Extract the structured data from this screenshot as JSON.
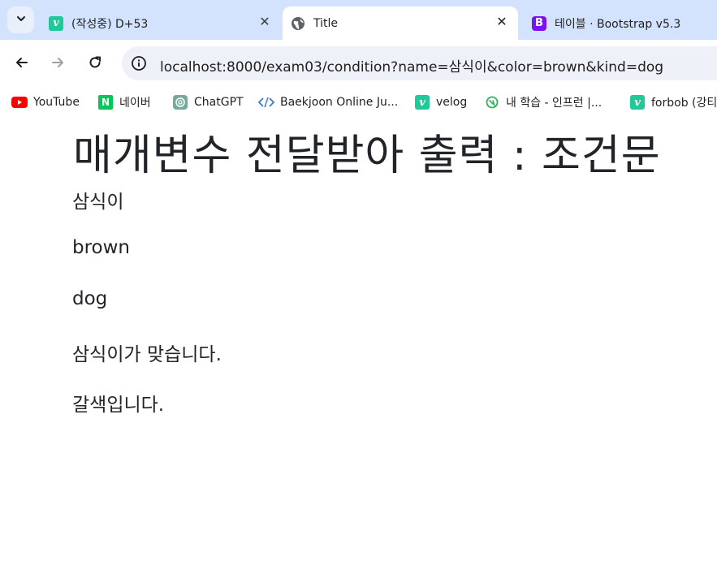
{
  "tabs": [
    {
      "title": "(작성중) D+53",
      "favicon": "velog-v-icon",
      "active": false
    },
    {
      "title": "Title",
      "favicon": "globe-icon",
      "active": true
    },
    {
      "title": "테이블 · Bootstrap v5.3",
      "favicon": "bootstrap-b-icon",
      "active": false
    }
  ],
  "omnibox": {
    "url": "localhost:8000/exam03/condition?name=삼식이&color=brown&kind=dog"
  },
  "bookmarks": [
    {
      "label": "YouTube",
      "icon": "youtube-icon"
    },
    {
      "label": "네이버",
      "icon": "naver-icon"
    },
    {
      "label": "ChatGPT",
      "icon": "chatgpt-icon"
    },
    {
      "label": "Baekjoon Online Ju...",
      "icon": "code-brackets-icon"
    },
    {
      "label": "velog",
      "icon": "velog-icon"
    },
    {
      "label": "내 학습 - 인프런 |...",
      "icon": "inflearn-icon"
    },
    {
      "label": "forbob (강티",
      "icon": "velog-icon"
    }
  ],
  "page": {
    "heading": "매개변수 전달받아 출력 : 조건문",
    "lines": [
      "삼식이",
      "brown",
      "dog",
      "삼식이가 맞습니다.",
      "갈색입니다."
    ]
  },
  "colors": {
    "tabstrip_bg": "#d3e3fd",
    "omnibox_bg": "#eef1f7",
    "velog_green": "#20c997",
    "bootstrap_purple": "#7a12f5"
  }
}
